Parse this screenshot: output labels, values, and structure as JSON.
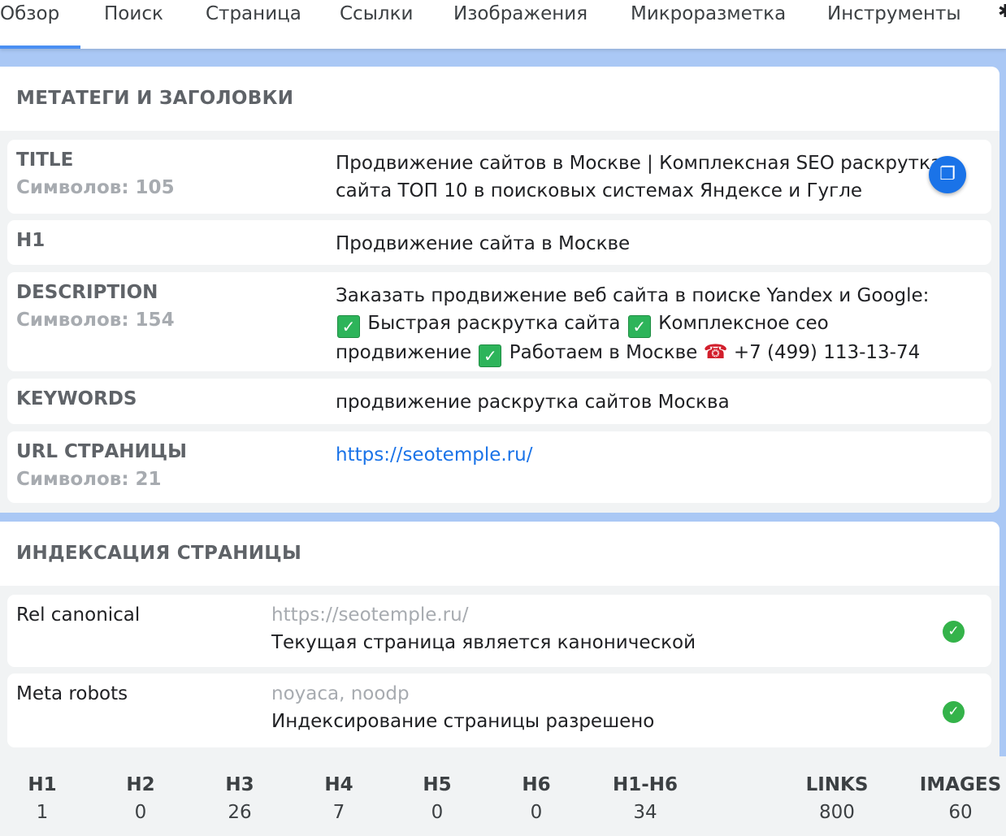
{
  "tabs": [
    {
      "label": "Обзор",
      "active": true
    },
    {
      "label": "Поиск"
    },
    {
      "label": "Страница"
    },
    {
      "label": "Ссылки"
    },
    {
      "label": "Изображения"
    },
    {
      "label": "Микроразметка"
    },
    {
      "label": "Инструменты"
    }
  ],
  "meta": {
    "title": "МЕТАТЕГИ И ЗАГОЛОВКИ",
    "title_row": {
      "label": "TITLE",
      "count": "Символов: 105",
      "value_line1": "Продвижение сайтов в Москве | Комплексная SEO раскрутка",
      "value_line2": "сайта ТОП 10 в поисковых системах Яндексе и Гугле"
    },
    "h1_row": {
      "label": "H1",
      "value": "Продвижение сайта в Москве"
    },
    "description_row": {
      "label": "DESCRIPTION",
      "count": "Символов: 154",
      "part1": "Заказать продвижение веб сайта в поиске Yandex и Google:",
      "part2": "Быстрая раскрутка сайта",
      "part3": "Комплексное сео",
      "part4": "продвижение",
      "part5": "Работаем в Москве",
      "phone": "+7 (499) 113-13-74"
    },
    "keywords_row": {
      "label": "KEYWORDS",
      "value": "продвижение раскрутка сайтов Москва"
    },
    "url_row": {
      "label": "URL СТРАНИЦЫ",
      "count": "Символов: 21",
      "value": "https://seotemple.ru/"
    }
  },
  "indexing": {
    "title": "ИНДЕКСАЦИЯ СТРАНИЦЫ",
    "canonical": {
      "label": "Rel canonical",
      "value": "https://seotemple.ru/",
      "note": "Текущая страница является канонической"
    },
    "robots": {
      "label": "Meta robots",
      "value": "noyaca, noodp",
      "note": "Индексирование страницы разрешено"
    }
  },
  "stats": [
    {
      "label": "H1",
      "value": "1"
    },
    {
      "label": "H2",
      "value": "0"
    },
    {
      "label": "H3",
      "value": "26"
    },
    {
      "label": "H4",
      "value": "7"
    },
    {
      "label": "H5",
      "value": "0"
    },
    {
      "label": "H6",
      "value": "0"
    },
    {
      "label": "H1-H6",
      "value": "34"
    },
    {
      "label": "LINKS",
      "value": "800"
    },
    {
      "label": "IMAGES",
      "value": "60"
    }
  ],
  "icons": {
    "copy": "copy-icon",
    "check_badge": "green-check-icon",
    "phone": "telephone-icon",
    "ok": "check-circle-icon"
  },
  "colors": {
    "accent": "#1a73e8",
    "tab_underline": "#4a8ff2",
    "ok_green": "#34b34a",
    "page_bg": "#aac8f5"
  }
}
